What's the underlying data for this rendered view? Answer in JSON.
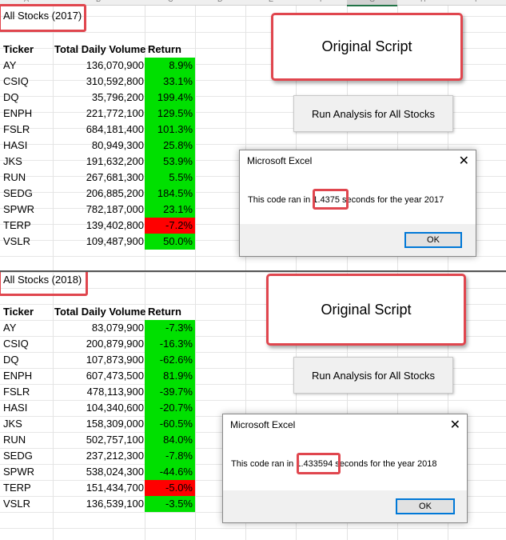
{
  "col_letters": [
    "A",
    "B",
    "C",
    "D",
    "E",
    "F",
    "G",
    "H",
    "I"
  ],
  "top": {
    "title": "All Stocks (2017)",
    "headers": {
      "ticker": "Ticker",
      "volume": "Total Daily Volume",
      "return": "Return"
    },
    "rows": [
      {
        "ticker": "AY",
        "volume": "136,070,900",
        "ret": "8.9%",
        "status": "positive"
      },
      {
        "ticker": "CSIQ",
        "volume": "310,592,800",
        "ret": "33.1%",
        "status": "positive"
      },
      {
        "ticker": "DQ",
        "volume": "35,796,200",
        "ret": "199.4%",
        "status": "positive"
      },
      {
        "ticker": "ENPH",
        "volume": "221,772,100",
        "ret": "129.5%",
        "status": "positive"
      },
      {
        "ticker": "FSLR",
        "volume": "684,181,400",
        "ret": "101.3%",
        "status": "positive"
      },
      {
        "ticker": "HASI",
        "volume": "80,949,300",
        "ret": "25.8%",
        "status": "positive"
      },
      {
        "ticker": "JKS",
        "volume": "191,632,200",
        "ret": "53.9%",
        "status": "positive"
      },
      {
        "ticker": "RUN",
        "volume": "267,681,300",
        "ret": "5.5%",
        "status": "positive"
      },
      {
        "ticker": "SEDG",
        "volume": "206,885,200",
        "ret": "184.5%",
        "status": "positive"
      },
      {
        "ticker": "SPWR",
        "volume": "782,187,000",
        "ret": "23.1%",
        "status": "positive"
      },
      {
        "ticker": "TERP",
        "volume": "139,402,800",
        "ret": "-7.2%",
        "status": "negative"
      },
      {
        "ticker": "VSLR",
        "volume": "109,487,900",
        "ret": "50.0%",
        "status": "positive"
      }
    ],
    "script_label": "Original Script",
    "run_button": "Run Analysis for All Stocks",
    "dialog": {
      "title": "Microsoft Excel",
      "msg_prefix": "This code ran in ",
      "seconds": "1.4375",
      "msg_suffix": " seconds for the year 2017",
      "ok": "OK",
      "close": "✕"
    }
  },
  "bottom": {
    "title": "All Stocks (2018)",
    "headers": {
      "ticker": "Ticker",
      "volume": "Total Daily Volume",
      "return": "Return"
    },
    "rows": [
      {
        "ticker": "AY",
        "volume": "83,079,900",
        "ret": "-7.3%",
        "status": "positive"
      },
      {
        "ticker": "CSIQ",
        "volume": "200,879,900",
        "ret": "-16.3%",
        "status": "positive"
      },
      {
        "ticker": "DQ",
        "volume": "107,873,900",
        "ret": "-62.6%",
        "status": "positive"
      },
      {
        "ticker": "ENPH",
        "volume": "607,473,500",
        "ret": "81.9%",
        "status": "positive"
      },
      {
        "ticker": "FSLR",
        "volume": "478,113,900",
        "ret": "-39.7%",
        "status": "positive"
      },
      {
        "ticker": "HASI",
        "volume": "104,340,600",
        "ret": "-20.7%",
        "status": "positive"
      },
      {
        "ticker": "JKS",
        "volume": "158,309,000",
        "ret": "-60.5%",
        "status": "positive"
      },
      {
        "ticker": "RUN",
        "volume": "502,757,100",
        "ret": "84.0%",
        "status": "positive"
      },
      {
        "ticker": "SEDG",
        "volume": "237,212,300",
        "ret": "-7.8%",
        "status": "positive"
      },
      {
        "ticker": "SPWR",
        "volume": "538,024,300",
        "ret": "-44.6%",
        "status": "positive"
      },
      {
        "ticker": "TERP",
        "volume": "151,434,700",
        "ret": "-5.0%",
        "status": "negative"
      },
      {
        "ticker": "VSLR",
        "volume": "136,539,100",
        "ret": "-3.5%",
        "status": "positive"
      }
    ],
    "script_label": "Original Script",
    "run_button": "Run Analysis for All Stocks",
    "dialog": {
      "title": "Microsoft Excel",
      "msg_prefix": "This code ran in ",
      "seconds": "1.433594",
      "msg_suffix": " seconds for the year 2018",
      "ok": "OK",
      "close": "✕"
    }
  },
  "colors": {
    "positive": "#00e000",
    "negative": "#ff0000",
    "highlight": "#e0464e"
  }
}
